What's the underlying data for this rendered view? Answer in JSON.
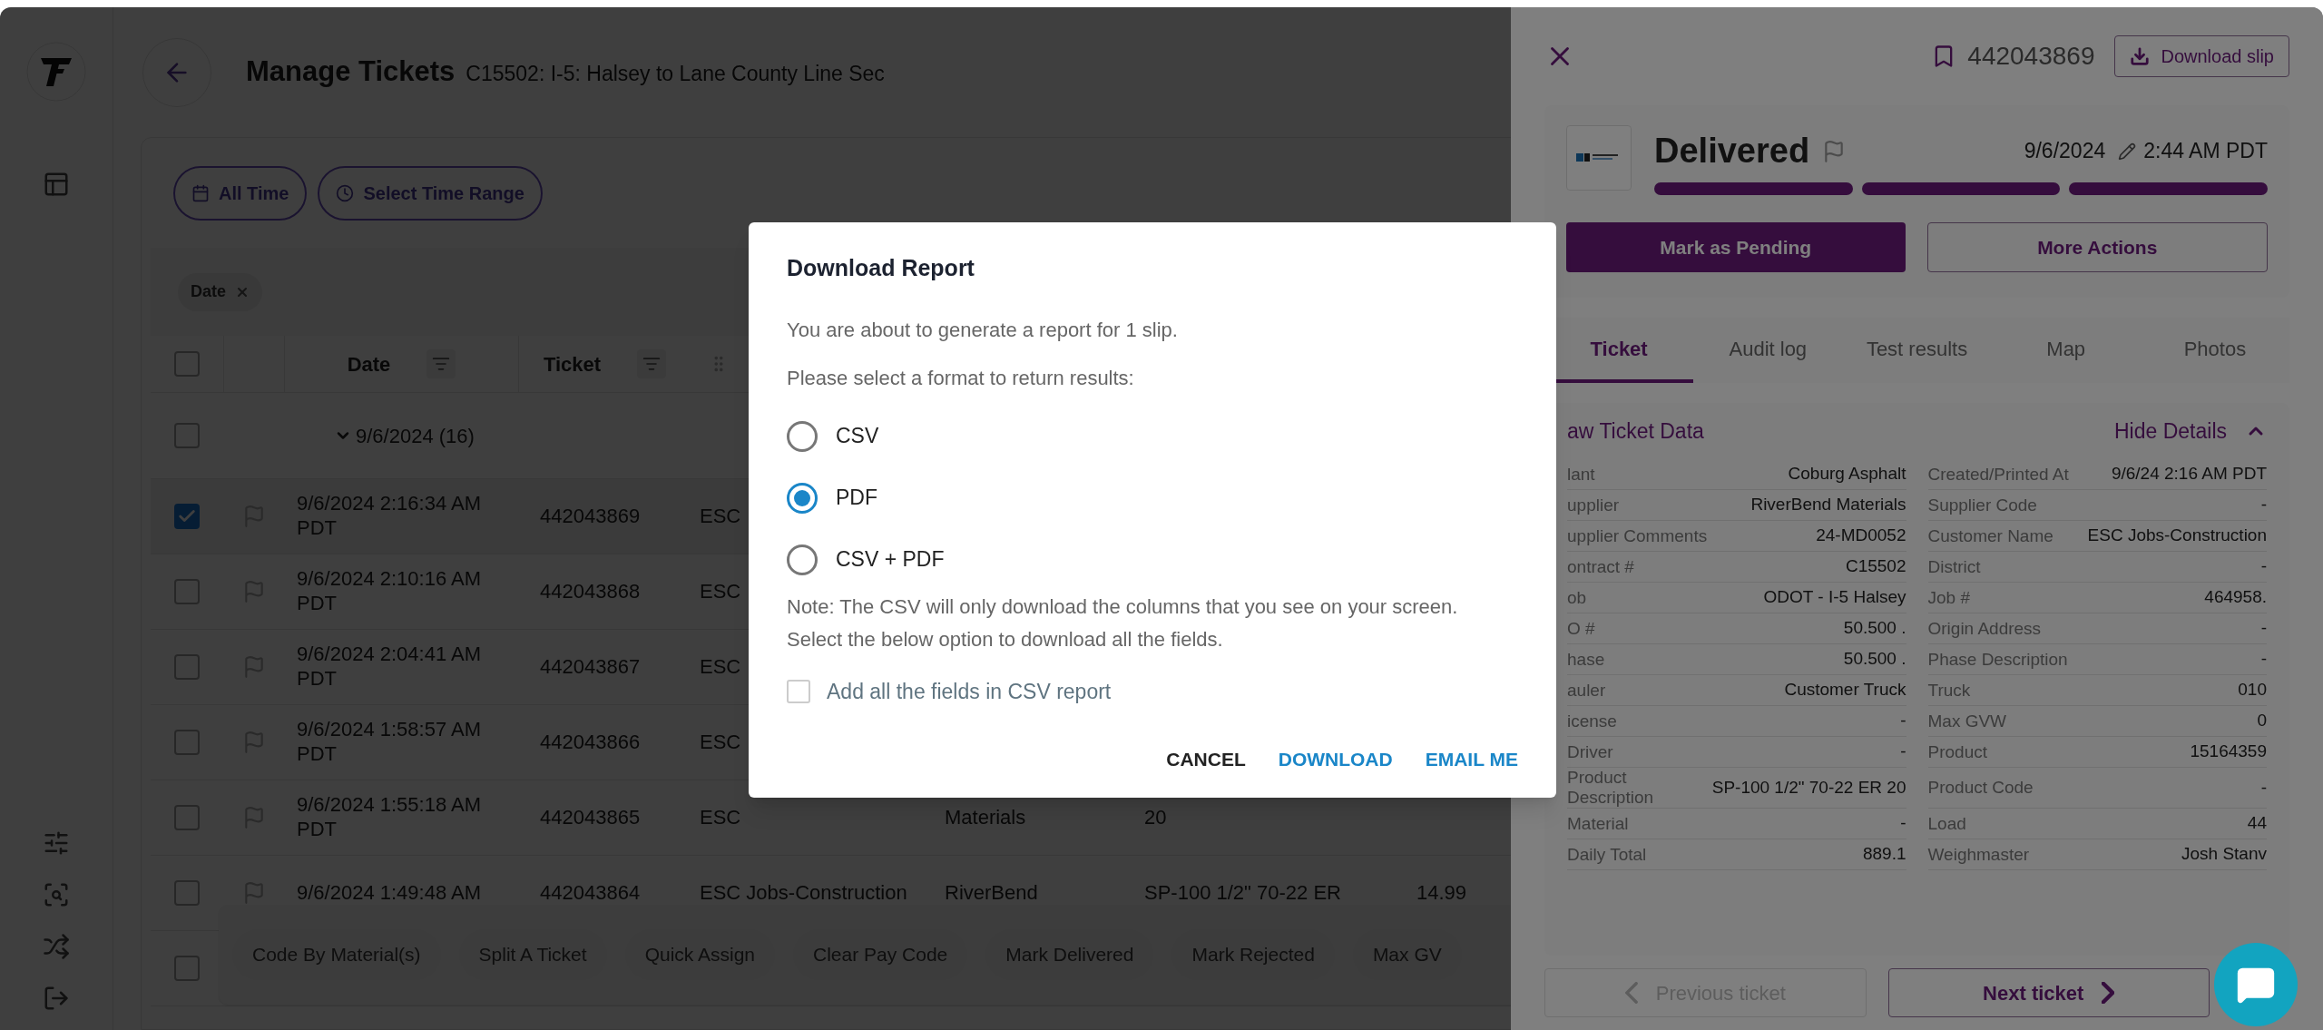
{
  "header": {
    "title": "Manage Tickets",
    "subtitle": "C15502: I-5: Halsey to Lane County Line Sec"
  },
  "filters": [
    {
      "label": "All Time",
      "kind": "calendar"
    },
    {
      "label": "Select Time Range",
      "kind": "clock"
    }
  ],
  "group_chips": [
    {
      "label": "Date"
    }
  ],
  "table": {
    "select_all": {
      "checked": false
    },
    "columns": [
      {
        "label": "Date"
      },
      {
        "label": "Ticket"
      }
    ],
    "group": {
      "label": "9/6/2024 (16)",
      "expanded": true,
      "checked": false
    },
    "rows": [
      {
        "checked": true,
        "cells": [
          "9/6/2024 2:16:34 AM PDT",
          "442043869",
          "ESC"
        ]
      },
      {
        "checked": false,
        "cells": [
          "9/6/2024 2:10:16 AM PDT",
          "442043868",
          "ESC"
        ]
      },
      {
        "checked": false,
        "cells": [
          "9/6/2024 2:04:41 AM PDT",
          "442043867",
          "ESC"
        ]
      },
      {
        "checked": false,
        "cells": [
          "9/6/2024 1:58:57 AM PDT",
          "442043866",
          "ESC"
        ]
      },
      {
        "checked": false,
        "cells": [
          "9/6/2024 1:55:18 AM PDT",
          "442043865",
          "ESC",
          "Materials",
          "20"
        ]
      },
      {
        "checked": false,
        "cells": [
          "9/6/2024 1:49:48 AM",
          "442043864",
          "ESC Jobs-Construction",
          "RiverBend",
          "SP-100 1/2\" 70-22 ER",
          "14.99"
        ]
      },
      {
        "checked": false
      }
    ]
  },
  "bulk_actions": [
    "Code By Material(s)",
    "Split A Ticket",
    "Quick Assign",
    "Clear Pay Code",
    "Mark Delivered",
    "Mark Rejected",
    "Max GV"
  ],
  "drawer": {
    "ticket_number": "442043869",
    "download_label": "Download slip",
    "status": "Delivered",
    "date": "9/6/2024",
    "time": "2:44 AM PDT",
    "steps": [
      {
        "complete": true
      },
      {
        "complete": true
      },
      {
        "complete": true
      }
    ],
    "primary_action": "Mark as Pending",
    "secondary_action": "More Actions",
    "tabs": [
      {
        "label": "Ticket",
        "selected": true
      },
      {
        "label": "Audit log",
        "selected": false
      },
      {
        "label": "Test results",
        "selected": false
      },
      {
        "label": "Map",
        "selected": false
      },
      {
        "label": "Photos",
        "selected": false
      }
    ],
    "details": {
      "title": "aw Ticket Data",
      "toggle": "Hide Details",
      "expanded": true,
      "left": [
        {
          "label": "lant",
          "value": "Coburg Asphalt"
        },
        {
          "label": "upplier",
          "value": "RiverBend Materials"
        },
        {
          "label": "upplier Comments",
          "value": "24-MD0052"
        },
        {
          "label": "ontract #",
          "value": "C15502"
        },
        {
          "label": "ob",
          "value": "ODOT - I-5 Halsey"
        },
        {
          "label": "O #",
          "value": "50.500  ."
        },
        {
          "label": "hase",
          "value": "50.500  ."
        },
        {
          "label": "auler",
          "value": "Customer Truck"
        },
        {
          "label": "icense",
          "value": "-"
        },
        {
          "label": "Driver",
          "value": "-"
        },
        {
          "label": "Product Description",
          "value": "SP-100 1/2\" 70-22 ER 20"
        },
        {
          "label": "Material",
          "value": "-"
        },
        {
          "label": "Daily Total",
          "value": "889.1"
        }
      ],
      "right": [
        {
          "label": "Created/Printed At",
          "value": "9/6/24 2:16 AM PDT"
        },
        {
          "label": "Supplier Code",
          "value": "-"
        },
        {
          "label": "Customer Name",
          "value": "ESC Jobs-Construction"
        },
        {
          "label": "District",
          "value": "-"
        },
        {
          "label": "Job #",
          "value": "464958."
        },
        {
          "label": "Origin Address",
          "value": "-"
        },
        {
          "label": "Phase Description",
          "value": "-"
        },
        {
          "label": "Truck",
          "value": "010"
        },
        {
          "label": "Max GVW",
          "value": "0"
        },
        {
          "label": "Product",
          "value": "15164359"
        },
        {
          "label": "Product Code",
          "value": "-"
        },
        {
          "label": "Load",
          "value": "44"
        },
        {
          "label": "Weighmaster",
          "value": "Josh Stanv"
        }
      ]
    },
    "previous": {
      "label": "Previous ticket",
      "disabled": true
    },
    "next": {
      "label": "Next ticket",
      "disabled": false
    }
  },
  "dialog": {
    "title": "Download Report",
    "lines": [
      "You are about to generate a report for 1 slip.",
      "Please select a format to return results:"
    ],
    "formats": [
      {
        "label": "CSV",
        "selected": false
      },
      {
        "label": "PDF",
        "selected": true
      },
      {
        "label": "CSV + PDF",
        "selected": false
      }
    ],
    "note": "Note: The CSV will only download the columns that you see on your screen. Select the below option to download all the fields.",
    "option": {
      "label": "Add all the fields in CSV report",
      "checked": false
    },
    "buttons": [
      {
        "label": "CANCEL",
        "kind": "neutral"
      },
      {
        "label": "DOWNLOAD",
        "kind": "primary"
      },
      {
        "label": "EMAIL ME",
        "kind": "primary"
      }
    ]
  }
}
